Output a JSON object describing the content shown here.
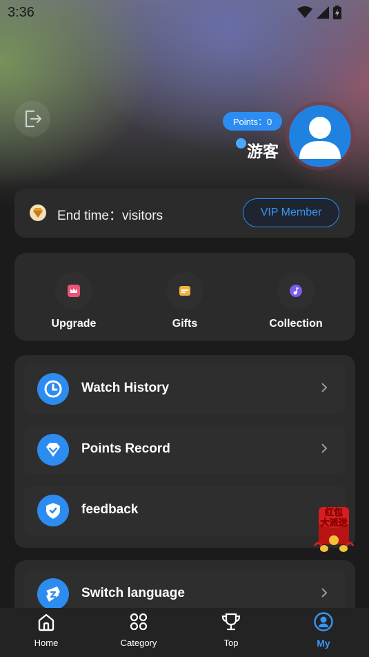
{
  "status_bar": {
    "time": "3:36"
  },
  "profile": {
    "points_label": "Points：0",
    "username": "游客"
  },
  "vip": {
    "end_time": "End time：visitors",
    "button_label": "VIP Member"
  },
  "actions": [
    {
      "label": "Upgrade",
      "icon": "crown-icon",
      "color": "#e9557a"
    },
    {
      "label": "Gifts",
      "icon": "card-icon",
      "color": "#f2b33d"
    },
    {
      "label": "Collection",
      "icon": "music-icon",
      "color": "#7a5cf0"
    }
  ],
  "menu": [
    {
      "label": "Watch History",
      "icon": "clock-icon"
    },
    {
      "label": "Points Record",
      "icon": "diamond-icon"
    },
    {
      "label": "feedback",
      "icon": "shield-icon"
    },
    {
      "label": "Switch language",
      "icon": "ticket-icon"
    }
  ],
  "promo": {
    "line1": "红包",
    "line2": "大派送"
  },
  "nav": [
    {
      "label": "Home",
      "icon": "home-icon"
    },
    {
      "label": "Category",
      "icon": "grid-icon"
    },
    {
      "label": "Top",
      "icon": "trophy-icon"
    },
    {
      "label": "My",
      "icon": "user-icon"
    }
  ],
  "colors": {
    "accent": "#2d8cf0",
    "card": "#2b2b2b",
    "background": "#1b1b1b"
  }
}
